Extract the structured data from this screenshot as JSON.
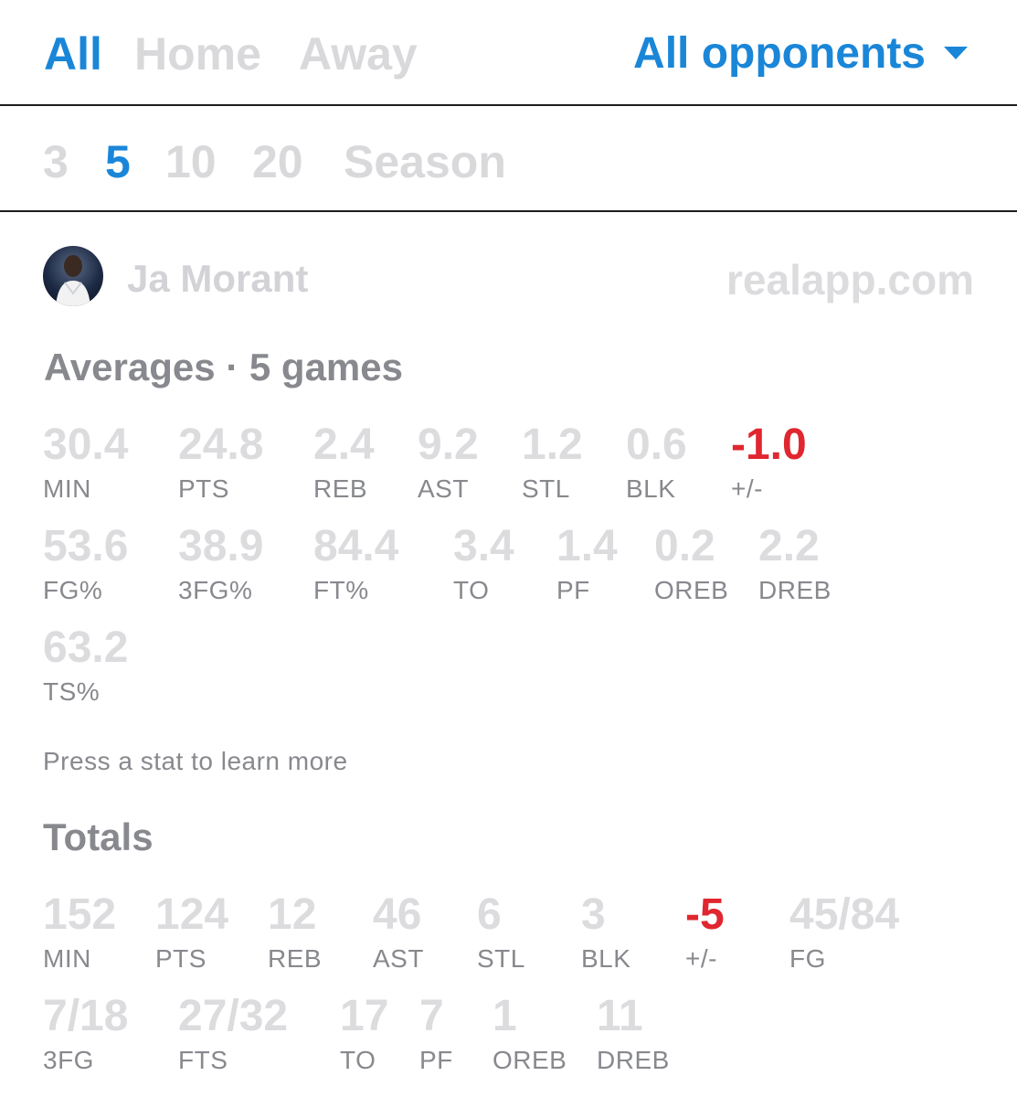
{
  "filters": {
    "location_tabs": [
      "All",
      "Home",
      "Away"
    ],
    "opponent_dropdown": "All opponents",
    "range_tabs": [
      "3",
      "5",
      "10",
      "20",
      "Season"
    ]
  },
  "player": {
    "name": "Ja Morant",
    "watermark": "realapp.com"
  },
  "averages": {
    "title": "Averages · 5 games",
    "row1": [
      {
        "value": "30.4",
        "label": "MIN"
      },
      {
        "value": "24.8",
        "label": "PTS"
      },
      {
        "value": "2.4",
        "label": "REB"
      },
      {
        "value": "9.2",
        "label": "AST"
      },
      {
        "value": "1.2",
        "label": "STL"
      },
      {
        "value": "0.6",
        "label": "BLK"
      },
      {
        "value": "-1.0",
        "label": "+/-"
      }
    ],
    "row2": [
      {
        "value": "53.6",
        "label": "FG%"
      },
      {
        "value": "38.9",
        "label": "3FG%"
      },
      {
        "value": "84.4",
        "label": "FT%"
      },
      {
        "value": "3.4",
        "label": "TO"
      },
      {
        "value": "1.4",
        "label": "PF"
      },
      {
        "value": "0.2",
        "label": "OREB"
      },
      {
        "value": "2.2",
        "label": "DREB"
      }
    ],
    "row3": [
      {
        "value": "63.2",
        "label": "TS%"
      }
    ]
  },
  "hint": "Press a stat to learn more",
  "totals": {
    "title": "Totals",
    "row1": [
      {
        "value": "152",
        "label": "MIN"
      },
      {
        "value": "124",
        "label": "PTS"
      },
      {
        "value": "12",
        "label": "REB"
      },
      {
        "value": "46",
        "label": "AST"
      },
      {
        "value": "6",
        "label": "STL"
      },
      {
        "value": "3",
        "label": "BLK"
      },
      {
        "value": "-5",
        "label": "+/-"
      },
      {
        "value": "45/84",
        "label": "FG"
      }
    ],
    "row2": [
      {
        "value": "7/18",
        "label": "3FG"
      },
      {
        "value": "27/32",
        "label": "FTS"
      },
      {
        "value": "17",
        "label": "TO"
      },
      {
        "value": "7",
        "label": "PF"
      },
      {
        "value": "1",
        "label": "OREB"
      },
      {
        "value": "11",
        "label": "DREB"
      }
    ]
  },
  "colors": {
    "accent": "#1a86d8",
    "negative": "#e0262f",
    "muted_value": "#dcdcdf",
    "label": "#88898e"
  }
}
